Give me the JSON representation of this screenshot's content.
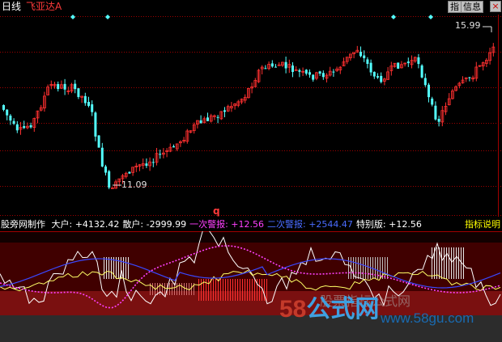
{
  "header": {
    "period_label": "日线",
    "stock_name": "飞亚达A"
  },
  "toolbar": {
    "zhi_label": "指",
    "info_label": "信息",
    "close_label": "×"
  },
  "price_labels": {
    "high": "15.99",
    "low": "11.09"
  },
  "marker_label": "q",
  "indicator_bar": {
    "name": "股旁网制作",
    "items": [
      {
        "label": "大户:",
        "value": "+4132.42",
        "color": "#ffffff"
      },
      {
        "label": "散户:",
        "value": "-2999.99",
        "color": "#ffffff"
      },
      {
        "label": "一次警报:",
        "value": "+12.56",
        "color": "#ff40ff"
      },
      {
        "label": "二次警报:",
        "value": "+2544.47",
        "color": "#4a6cff"
      },
      {
        "label": "特别版:",
        "value": "+12.56",
        "color": "#ffffff"
      }
    ],
    "help_label": "指标说明"
  },
  "watermark": {
    "digits": "58",
    "brand": "公式网",
    "url": "www.58gu.com",
    "ghost_text": "股票指标公式网"
  },
  "colors": {
    "up_candle": "#ff3030",
    "down_candle": "#54ffff",
    "grid": "#a00000",
    "panel_dark": "#400000",
    "panel_red": "#7a1010",
    "line_white": "#ffffff",
    "line_yellow": "#ffff66",
    "line_blue": "#3a48ff",
    "line_magenta": "#ff40ff",
    "watermark_58": "#c43a2a",
    "watermark_brand": "#3fa0e0"
  },
  "icons": [
    "diamond-marker-icon",
    "close-icon"
  ]
}
